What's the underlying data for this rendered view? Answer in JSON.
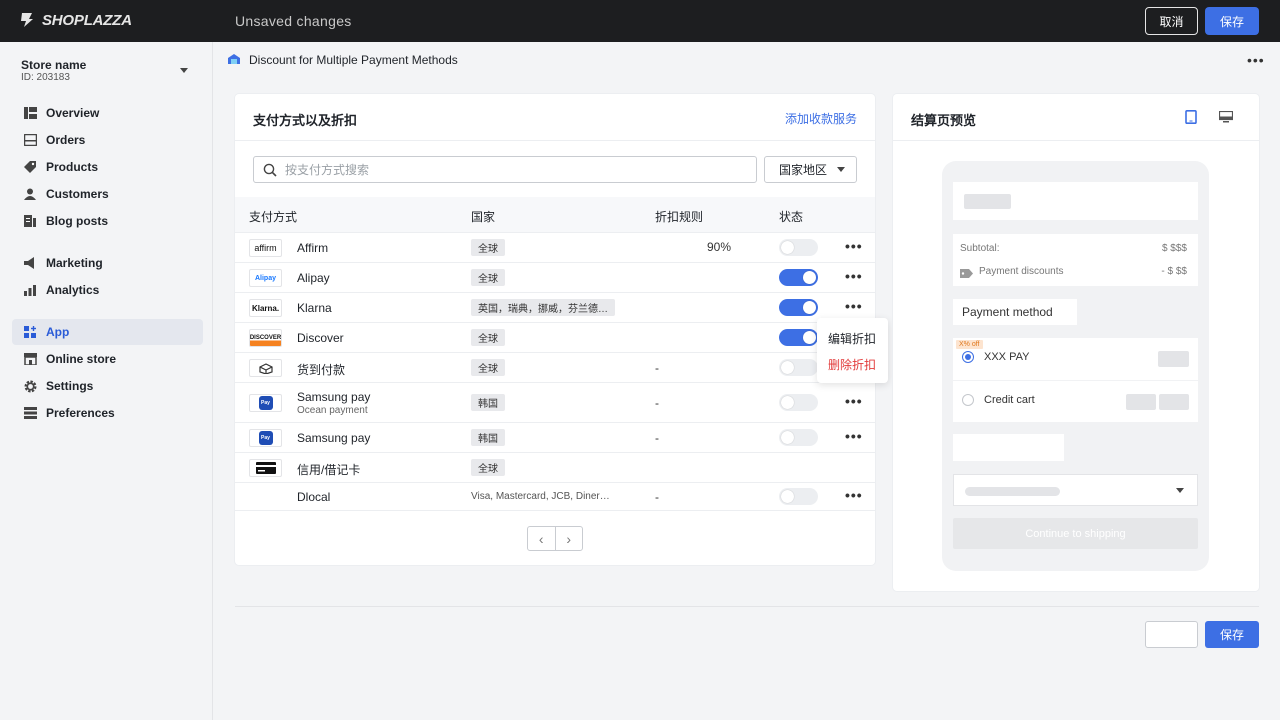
{
  "topbar": {
    "logo_text": "SHOPLAZZA",
    "status": "Unsaved changes",
    "cancel_label": "取消",
    "save_label": "保存"
  },
  "sidebar": {
    "store_name": "Store name",
    "store_id": "ID: 203183",
    "items": [
      {
        "label": "Overview",
        "icon": "overview-icon"
      },
      {
        "label": "Orders",
        "icon": "orders-icon"
      },
      {
        "label": "Products",
        "icon": "products-icon"
      },
      {
        "label": "Customers",
        "icon": "customers-icon"
      },
      {
        "label": "Blog posts",
        "icon": "blog-icon"
      },
      {
        "label": "Marketing",
        "icon": "marketing-icon"
      },
      {
        "label": "Analytics",
        "icon": "analytics-icon"
      },
      {
        "label": "App",
        "icon": "app-icon",
        "active": true
      },
      {
        "label": "Online store",
        "icon": "store-icon"
      },
      {
        "label": "Settings",
        "icon": "gear-icon"
      },
      {
        "label": "Preferences",
        "icon": "preferences-icon"
      }
    ]
  },
  "page": {
    "title": "Discount for Multiple Payment Methods",
    "more": "•••"
  },
  "methods_card": {
    "title": "支付方式以及折扣",
    "add_link": "添加收款服务",
    "search_placeholder": "按支付方式搜索",
    "region_label": "国家地区",
    "columns": [
      "支付方式",
      "国家",
      "折扣规则",
      "状态"
    ],
    "rows": [
      {
        "logo": "affirm",
        "name": "Affirm",
        "sub": "",
        "country": "全球",
        "rule": "90%",
        "status": "off",
        "menu": "•••"
      },
      {
        "logo": "Alipay",
        "name": "Alipay",
        "sub": "",
        "country": "全球",
        "rule": "",
        "status": "on",
        "menu": "•••"
      },
      {
        "logo": "Klarna.",
        "name": "Klarna",
        "sub": "",
        "country": "英国，瑞典，挪威，芬兰德…",
        "rule": "",
        "status": "on",
        "menu": "•••"
      },
      {
        "logo": "DISCOVER",
        "name": "Discover",
        "sub": "",
        "country": "全球",
        "rule": "",
        "status": "on",
        "menu": ""
      },
      {
        "logo": "cod",
        "name": "货到付款",
        "sub": "",
        "country": "全球",
        "rule": "-",
        "status": "off",
        "menu": ""
      },
      {
        "logo": "Pay",
        "name": "Samsung pay",
        "sub": "Ocean payment",
        "country": "韩国",
        "rule": "-",
        "status": "off",
        "menu": "•••"
      },
      {
        "logo": "Pay",
        "name": "Samsung pay",
        "sub": "",
        "country": "韩国",
        "rule": "-",
        "status": "off",
        "menu": "•••"
      },
      {
        "logo": "card",
        "name": "信用/借记卡",
        "sub": "",
        "country": "全球",
        "rule": "",
        "status": "",
        "menu": ""
      },
      {
        "logo": "",
        "name": "Dlocal",
        "sub": "",
        "country": "Visa, Mastercard, JCB, Diner…",
        "rule": "-",
        "status": "off",
        "menu": "•••"
      }
    ],
    "context_menu": {
      "edit": "编辑折扣",
      "delete": "删除折扣"
    }
  },
  "preview_card": {
    "title": "结算页预览",
    "subtotal_label": "Subtotal:",
    "subtotal_value": "$ $$$",
    "discount_label": "Payment discounts",
    "discount_value": "- $ $$",
    "payment_method_label": "Payment method",
    "promo_badge": "X% off",
    "option1": "XXX PAY",
    "option2": "Credit cart",
    "continue_label": "Continue to shipping"
  },
  "footer": {
    "save_label": "保存"
  },
  "colors": {
    "accent": "#3d6fe4",
    "danger": "#e23b3b",
    "topbar": "#1d1e20"
  }
}
